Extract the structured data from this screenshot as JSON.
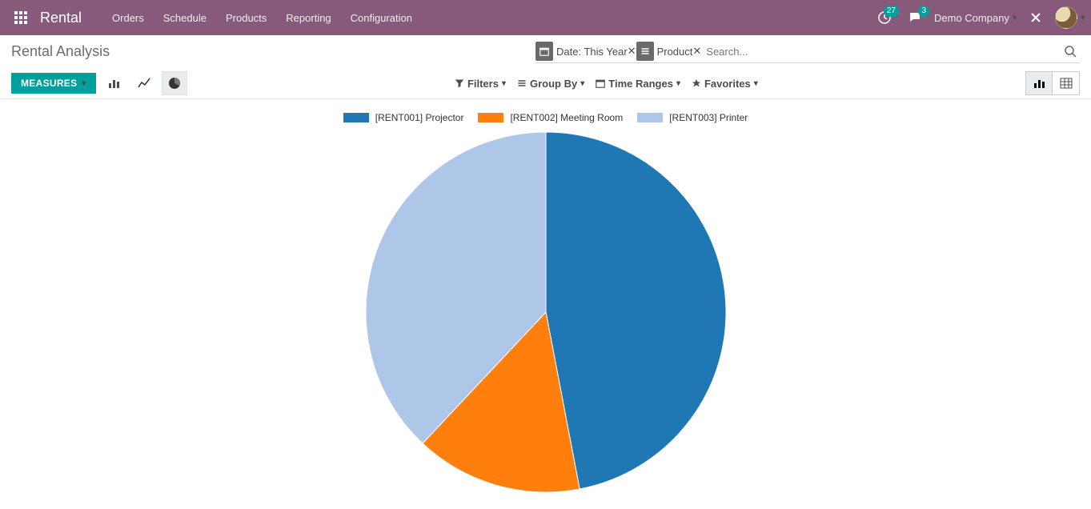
{
  "navbar": {
    "brand": "Rental",
    "menu": [
      "Orders",
      "Schedule",
      "Products",
      "Reporting",
      "Configuration"
    ],
    "activities_count": "27",
    "messages_count": "3",
    "company": "Demo Company"
  },
  "page": {
    "title": "Rental Analysis"
  },
  "search": {
    "placeholder": "Search...",
    "facets": [
      {
        "icon": "calendar",
        "label": "Date: This Year"
      },
      {
        "icon": "list",
        "label": "Product"
      }
    ]
  },
  "buttons": {
    "measures": "MEASURES"
  },
  "filters": {
    "filters": "Filters",
    "groupby": "Group By",
    "timeranges": "Time Ranges",
    "favorites": "Favorites"
  },
  "chart_data": {
    "type": "pie",
    "title": "Rental Analysis",
    "series": [
      {
        "name": "[RENT001] Projector",
        "value": 47,
        "color": "#1f77b4"
      },
      {
        "name": "[RENT002] Meeting Room",
        "value": 15,
        "color": "#ff7f0e"
      },
      {
        "name": "[RENT003] Printer",
        "value": 38,
        "color": "#aec7e8"
      }
    ]
  }
}
